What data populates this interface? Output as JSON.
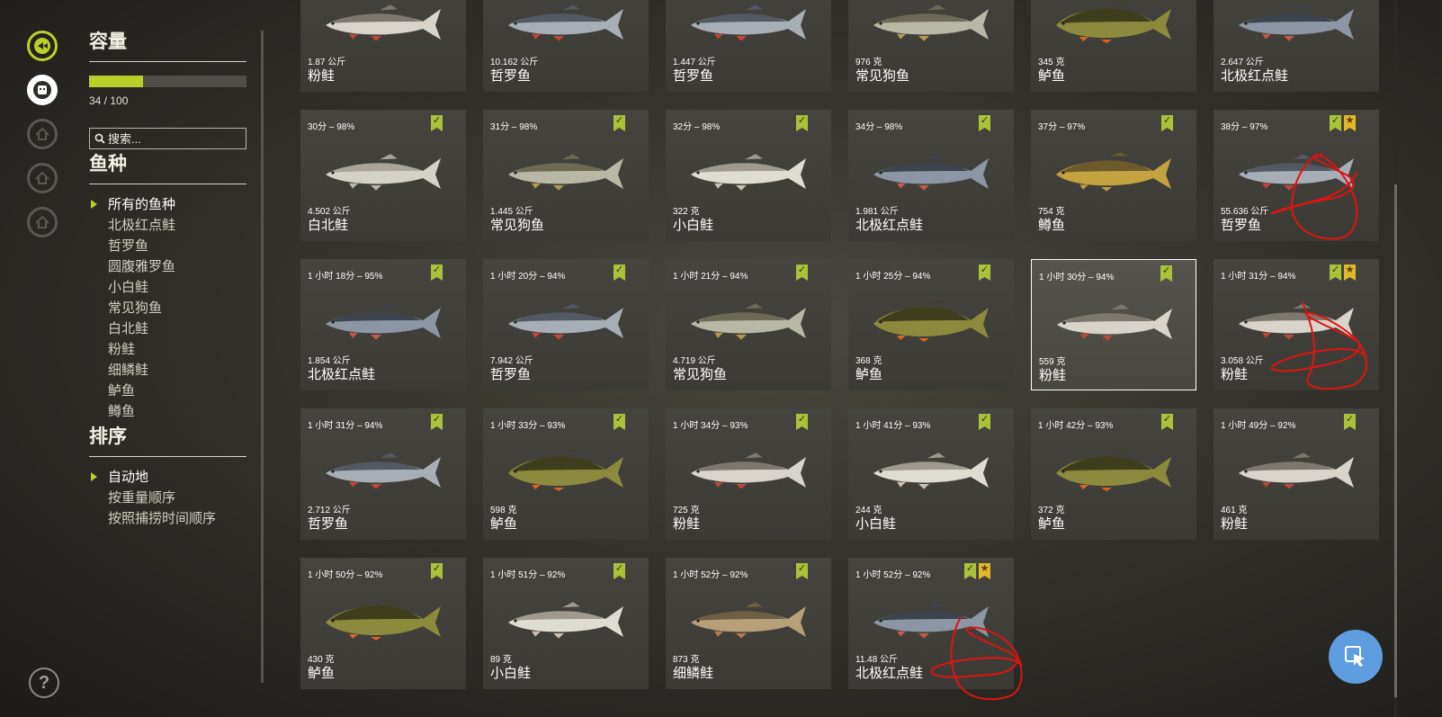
{
  "rail": {
    "icons": [
      "fish-nav-icon",
      "keepnet-icon",
      "locked-tab-icon-1",
      "locked-tab-icon-2",
      "locked-tab-icon-3"
    ],
    "help_label": "?"
  },
  "panel": {
    "capacity_title": "容量",
    "capacity_current": 34,
    "capacity_max": 100,
    "capacity_text": "34 / 100",
    "search_placeholder": "搜索...",
    "species_title": "鱼种",
    "species": [
      "所有的鱼种",
      "北极红点鲑",
      "哲罗鱼",
      "圆腹雅罗鱼",
      "小白鲑",
      "常见狗鱼",
      "白北鲑",
      "粉鲑",
      "细鳞鲑",
      "鲈鱼",
      "鳟鱼"
    ],
    "sort_title": "排序",
    "sort_options": [
      "自动地",
      "按重量顺序",
      "按照捕捞时间顺序"
    ]
  },
  "colors": {
    "accent": "#b8d12a",
    "star": "#e2b72a",
    "annotation": "#e0130f",
    "fab": "#5d9de0"
  },
  "fish": [
    {
      "time": "",
      "weight": "1.87 公斤",
      "name": "粉鲑",
      "kind": "salmon",
      "badges": []
    },
    {
      "time": "",
      "weight": "10.162 公斤",
      "name": "哲罗鱼",
      "kind": "taimen",
      "badges": []
    },
    {
      "time": "",
      "weight": "1.447 公斤",
      "name": "哲罗鱼",
      "kind": "taimen",
      "badges": []
    },
    {
      "time": "",
      "weight": "976 克",
      "name": "常见狗鱼",
      "kind": "pike",
      "badges": []
    },
    {
      "time": "",
      "weight": "345 克",
      "name": "鲈鱼",
      "kind": "perch",
      "badges": []
    },
    {
      "time": "",
      "weight": "2.647 公斤",
      "name": "北极红点鲑",
      "kind": "char",
      "badges": []
    },
    {
      "time": "30分 – 98%",
      "weight": "4.502 公斤",
      "name": "白北鲑",
      "kind": "nelma",
      "badges": [
        "ok"
      ]
    },
    {
      "time": "31分 – 98%",
      "weight": "1.445 公斤",
      "name": "常见狗鱼",
      "kind": "pike",
      "badges": [
        "ok"
      ]
    },
    {
      "time": "32分 – 98%",
      "weight": "322 克",
      "name": "小白鲑",
      "kind": "whitefish",
      "badges": [
        "ok"
      ]
    },
    {
      "time": "34分 – 98%",
      "weight": "1.981 公斤",
      "name": "北极红点鲑",
      "kind": "char",
      "badges": [
        "ok"
      ]
    },
    {
      "time": "37分 – 97%",
      "weight": "754 克",
      "name": "鳟鱼",
      "kind": "trout",
      "badges": [
        "ok"
      ]
    },
    {
      "time": "38分 – 97%",
      "weight": "55.636 公斤",
      "name": "哲罗鱼",
      "kind": "taimen",
      "badges": [
        "ok",
        "star"
      ]
    },
    {
      "time": "1 小时 18分 – 95%",
      "weight": "1.854 公斤",
      "name": "北极红点鲑",
      "kind": "char",
      "badges": [
        "ok"
      ]
    },
    {
      "time": "1 小时 20分 – 94%",
      "weight": "7.942 公斤",
      "name": "哲罗鱼",
      "kind": "taimen",
      "badges": [
        "ok"
      ]
    },
    {
      "time": "1 小时 21分 – 94%",
      "weight": "4.719 公斤",
      "name": "常见狗鱼",
      "kind": "pike",
      "badges": [
        "ok"
      ]
    },
    {
      "time": "1 小时 25分 – 94%",
      "weight": "368 克",
      "name": "鲈鱼",
      "kind": "perch",
      "badges": [
        "ok"
      ]
    },
    {
      "time": "1 小时 30分 – 94%",
      "weight": "559 克",
      "name": "粉鲑",
      "kind": "salmon",
      "badges": [
        "ok"
      ]
    },
    {
      "time": "1 小时 31分 – 94%",
      "weight": "3.058 公斤",
      "name": "粉鲑",
      "kind": "salmon",
      "badges": [
        "ok",
        "star"
      ]
    },
    {
      "time": "1 小时 31分 – 94%",
      "weight": "2.712 公斤",
      "name": "哲罗鱼",
      "kind": "taimen",
      "badges": [
        "ok"
      ]
    },
    {
      "time": "1 小时 33分 – 93%",
      "weight": "598 克",
      "name": "鲈鱼",
      "kind": "perch",
      "badges": [
        "ok"
      ]
    },
    {
      "time": "1 小时 34分 – 93%",
      "weight": "725 克",
      "name": "粉鲑",
      "kind": "salmon",
      "badges": [
        "ok"
      ]
    },
    {
      "time": "1 小时 41分 – 93%",
      "weight": "244 克",
      "name": "小白鲑",
      "kind": "whitefish",
      "badges": [
        "ok"
      ]
    },
    {
      "time": "1 小时 42分 – 93%",
      "weight": "372 克",
      "name": "鲈鱼",
      "kind": "perch",
      "badges": [
        "ok"
      ]
    },
    {
      "time": "1 小时 49分 – 92%",
      "weight": "461 克",
      "name": "粉鲑",
      "kind": "salmon",
      "badges": [
        "ok"
      ]
    },
    {
      "time": "1 小时 50分 – 92%",
      "weight": "430 克",
      "name": "鲈鱼",
      "kind": "perch",
      "badges": [
        "ok"
      ]
    },
    {
      "time": "1 小时 51分 – 92%",
      "weight": "89 克",
      "name": "小白鲑",
      "kind": "whitefish",
      "badges": [
        "ok"
      ]
    },
    {
      "time": "1 小时 52分 – 92%",
      "weight": "873 克",
      "name": "细鳞鲑",
      "kind": "lenok",
      "badges": [
        "ok"
      ]
    },
    {
      "time": "1 小时 52分 – 92%",
      "weight": "11.48 公斤",
      "name": "北极红点鲑",
      "kind": "char",
      "badges": [
        "ok",
        "star"
      ]
    }
  ]
}
